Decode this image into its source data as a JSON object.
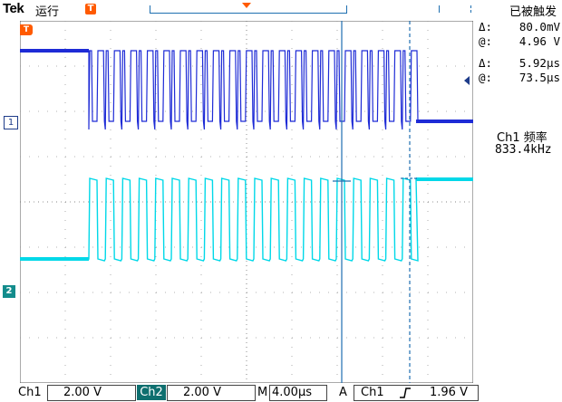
{
  "header": {
    "brand": "Tek",
    "run_state": "运行",
    "trigger_state": "已被触发",
    "trigger_position_marker": "T"
  },
  "readouts": {
    "volt_delta_symbol": "Δ:",
    "volt_delta_value": "80.0mV",
    "volt_at_symbol": "@:",
    "volt_at_value": "4.96 V",
    "time_delta_symbol": "Δ:",
    "time_delta_value": "5.92μs",
    "time_at_symbol": "@:",
    "time_at_value": "73.5μs",
    "freq_label": "Ch1 频率",
    "freq_value": "833.4kHz"
  },
  "markers": {
    "ch1": "1",
    "ch2": "2",
    "trigger": "T"
  },
  "footer": {
    "ch1_label": "Ch1",
    "ch1_scale": "2.00 V",
    "ch2_label": "Ch2",
    "ch2_scale": "2.00 V",
    "timebase_label": "M",
    "timebase_value": "4.00µs",
    "trigger_mode": "A",
    "trigger_source": "Ch1",
    "trigger_level": "1.96 V"
  },
  "colors": {
    "ch1": "#1e2bd6",
    "ch2": "#00d8e8",
    "trigger": "#ff5a00",
    "cursor": "#1e6fb0"
  },
  "icons": {
    "trigger_slope": "rising-edge-icon",
    "cursor_pointer": "cursor-arrow-icon"
  }
}
